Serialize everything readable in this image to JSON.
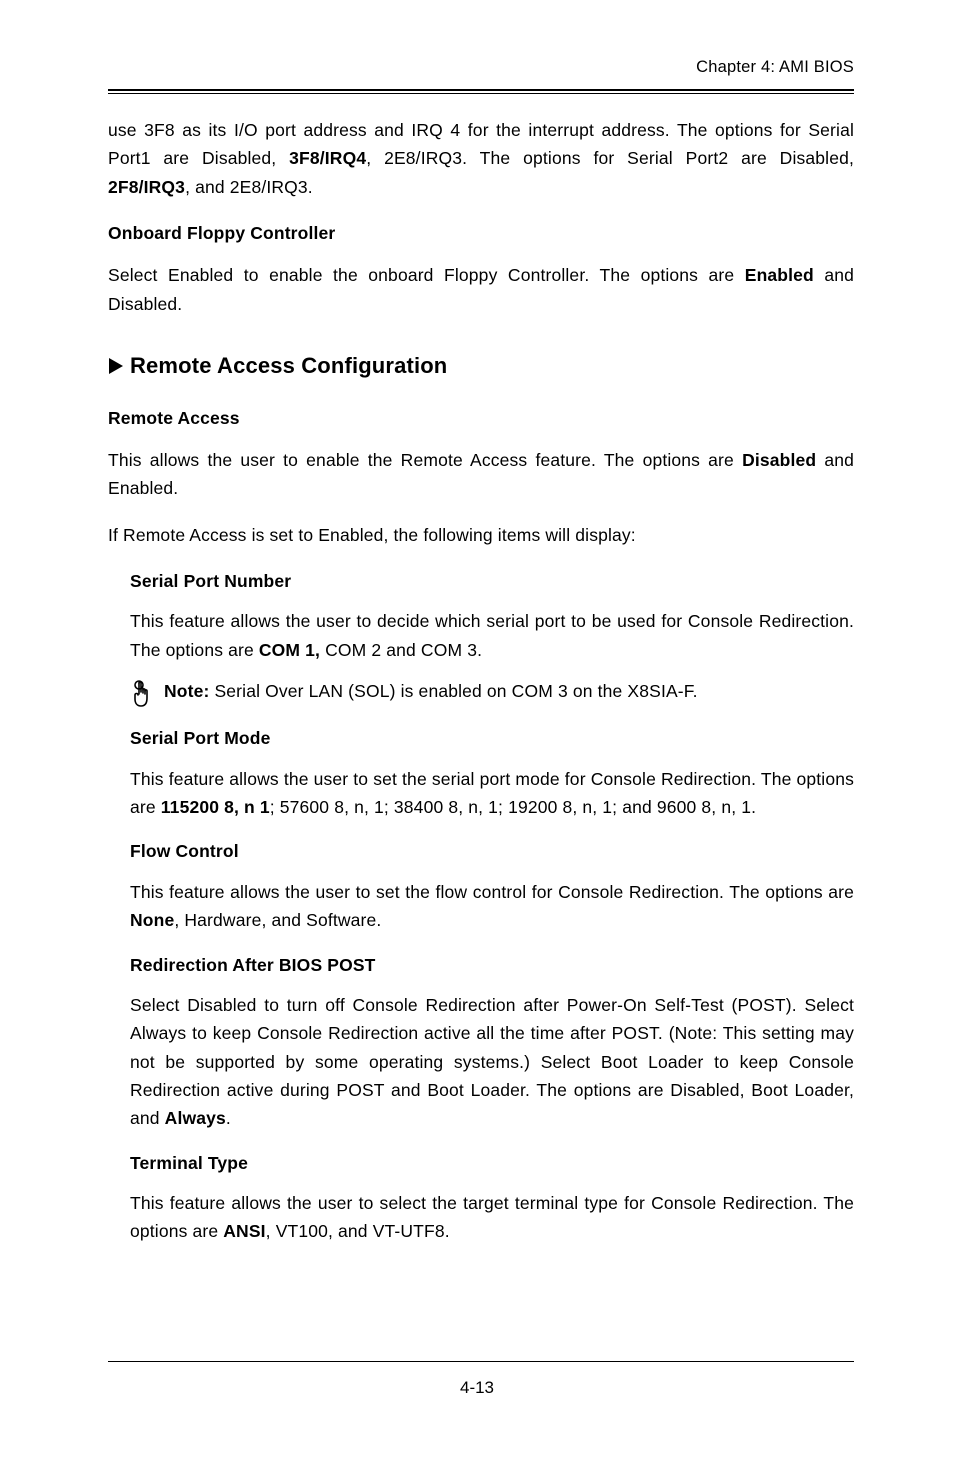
{
  "header": {
    "text": "Chapter 4: AMI BIOS"
  },
  "intro_para": {
    "pre": "use 3F8 as its I/O port address and IRQ 4 for the interrupt address. The options for Serial Port1 are Disabled, ",
    "b1": "3F8/IRQ4",
    "mid1": ", 2E8/IRQ3. The options for Serial Port2 are Disabled, ",
    "b2": "2F8/IRQ3",
    "post": ", and 2E8/IRQ3."
  },
  "onboard_floppy": {
    "title": "Onboard Floppy Controller",
    "text_pre": "Select Enabled to enable the onboard Floppy Controller. The options are ",
    "b": "Enabled",
    "text_post": " and Disabled."
  },
  "remote_access_heading": "Remote Access Configuration",
  "remote_access": {
    "title": "Remote Access",
    "para1_pre": "This allows the user to enable the Remote Access feature. The options are ",
    "para1_b": "Disabled",
    "para1_post": " and Enabled.",
    "para2": "If Remote Access is set to Enabled, the following items will display:"
  },
  "serial_port_number": {
    "title": "Serial Port Number",
    "text_pre": "This feature allows the user to decide which serial port to be used for Console Redirection. The options are ",
    "b": "COM 1,",
    "text_post": " COM 2 and COM 3."
  },
  "note": {
    "b": "Note:",
    "text": " Serial Over LAN (SOL) is enabled on COM 3 on the X8SIA-F."
  },
  "serial_port_mode": {
    "title": "Serial Port Mode",
    "text_pre": "This feature allows the user to set the serial port mode for Console Redirection. The options are ",
    "b": "115200 8, n 1",
    "text_post": "; 57600 8, n, 1; 38400 8, n, 1; 19200 8, n, 1; and 9600 8, n, 1."
  },
  "flow_control": {
    "title": "Flow Control",
    "text_pre": "This feature allows the user to set the flow control for Console Redirection. The options are ",
    "b": "None",
    "text_post": ", Hardware, and Software."
  },
  "redirection": {
    "title": "Redirection After BIOS POST",
    "text_pre": "Select Disabled to turn off Console Redirection after Power-On Self-Test (POST). Select Always to keep Console Redirection active all the time after POST. (Note: This setting may not be supported by some operating systems.) Select Boot Loader to keep Console Redirection active during POST and Boot Loader. The options are Disabled, Boot Loader, and ",
    "b": "Always",
    "text_post": "."
  },
  "terminal_type": {
    "title": "Terminal Type",
    "text_pre": "This feature allows the user to select the target terminal type for Console Redirection. The options are ",
    "b": "ANSI",
    "text_post": ", VT100, and VT-UTF8."
  },
  "page_number": "4-13"
}
